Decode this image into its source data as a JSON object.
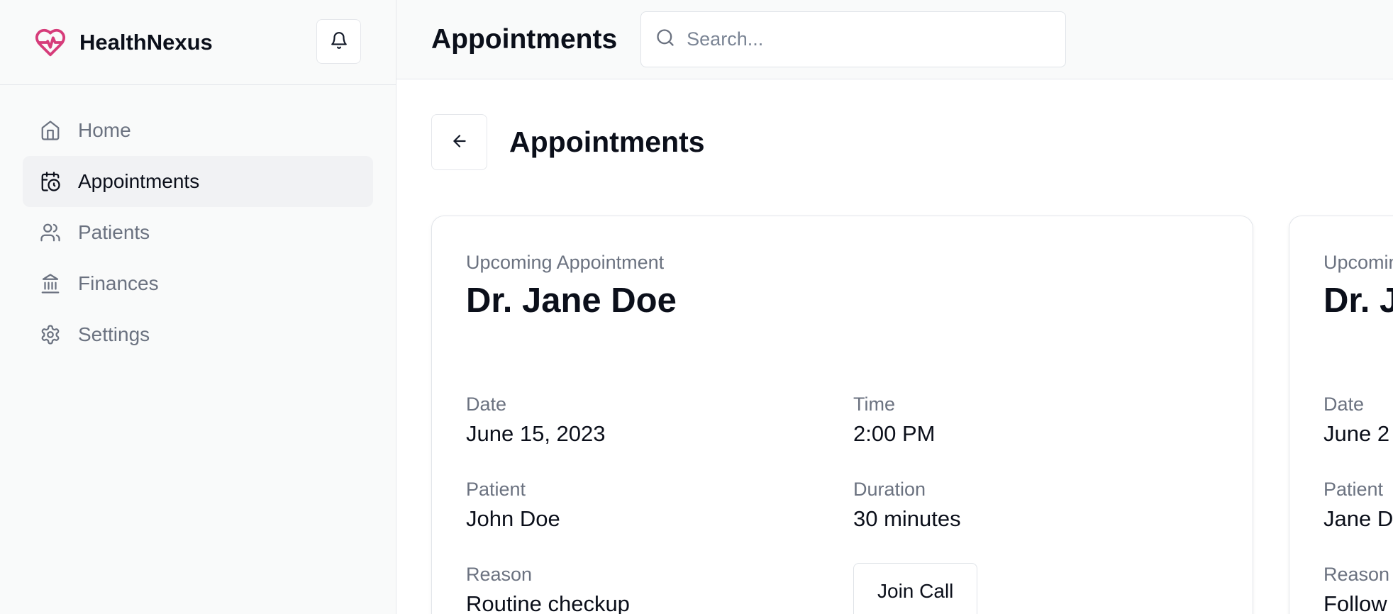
{
  "brand": {
    "name": "HealthNexus",
    "accent": "#d63c7a"
  },
  "sidebar": {
    "items": [
      {
        "label": "Home",
        "icon": "home-icon",
        "active": false
      },
      {
        "label": "Appointments",
        "icon": "calendar-clock-icon",
        "active": true
      },
      {
        "label": "Patients",
        "icon": "users-icon",
        "active": false
      },
      {
        "label": "Finances",
        "icon": "landmark-icon",
        "active": false
      },
      {
        "label": "Settings",
        "icon": "gear-icon",
        "active": false
      }
    ]
  },
  "header": {
    "title": "Appointments",
    "search_placeholder": "Search..."
  },
  "page": {
    "title": "Appointments"
  },
  "appointments": [
    {
      "eyebrow": "Upcoming Appointment",
      "doctor": "Dr. Jane Doe",
      "date_label": "Date",
      "date": "June 15, 2023",
      "time_label": "Time",
      "time": "2:00 PM",
      "patient_label": "Patient",
      "patient": "John Doe",
      "duration_label": "Duration",
      "duration": "30 minutes",
      "reason_label": "Reason",
      "reason": "Routine checkup",
      "action_label": "Join Call"
    },
    {
      "eyebrow": "Upcoming Appointment",
      "doctor": "Dr. J",
      "date_label": "Date",
      "date": "June 2",
      "patient_label": "Patient",
      "patient": "Jane D",
      "reason_label": "Reason",
      "reason": "Follow"
    }
  ]
}
